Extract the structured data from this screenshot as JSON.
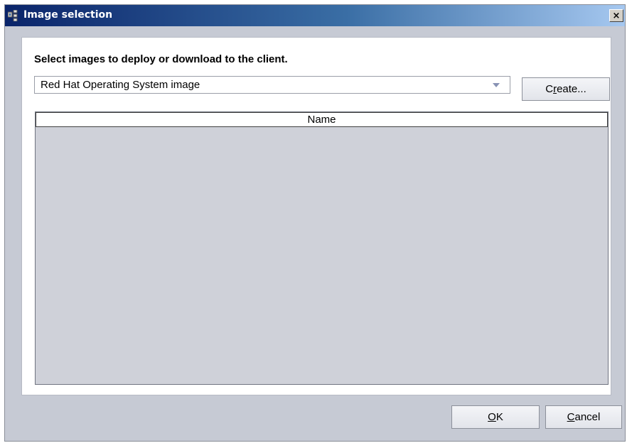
{
  "window": {
    "title": "Image selection",
    "close_glyph": "×"
  },
  "dialog": {
    "instruction": "Select images to deploy or download to the client.",
    "image_type_select": {
      "selected": "Red Hat Operating System image"
    },
    "create_button": {
      "pre": "C",
      "mnemonic": "r",
      "post": "eate..."
    },
    "table": {
      "columns": [
        "Name"
      ],
      "rows": []
    },
    "ok_button": {
      "pre": "",
      "mnemonic": "O",
      "post": "K"
    },
    "cancel_button": {
      "pre": "",
      "mnemonic": "C",
      "post": "ancel"
    }
  },
  "icons": {
    "title_icon": "app-window-icon",
    "combo_arrow": "dropdown-arrow-icon"
  },
  "colors": {
    "titlebar_start": "#0a246a",
    "titlebar_end": "#a6c8f0",
    "window_bg": "#c6cad4",
    "table_bg": "#cfd1d9"
  }
}
